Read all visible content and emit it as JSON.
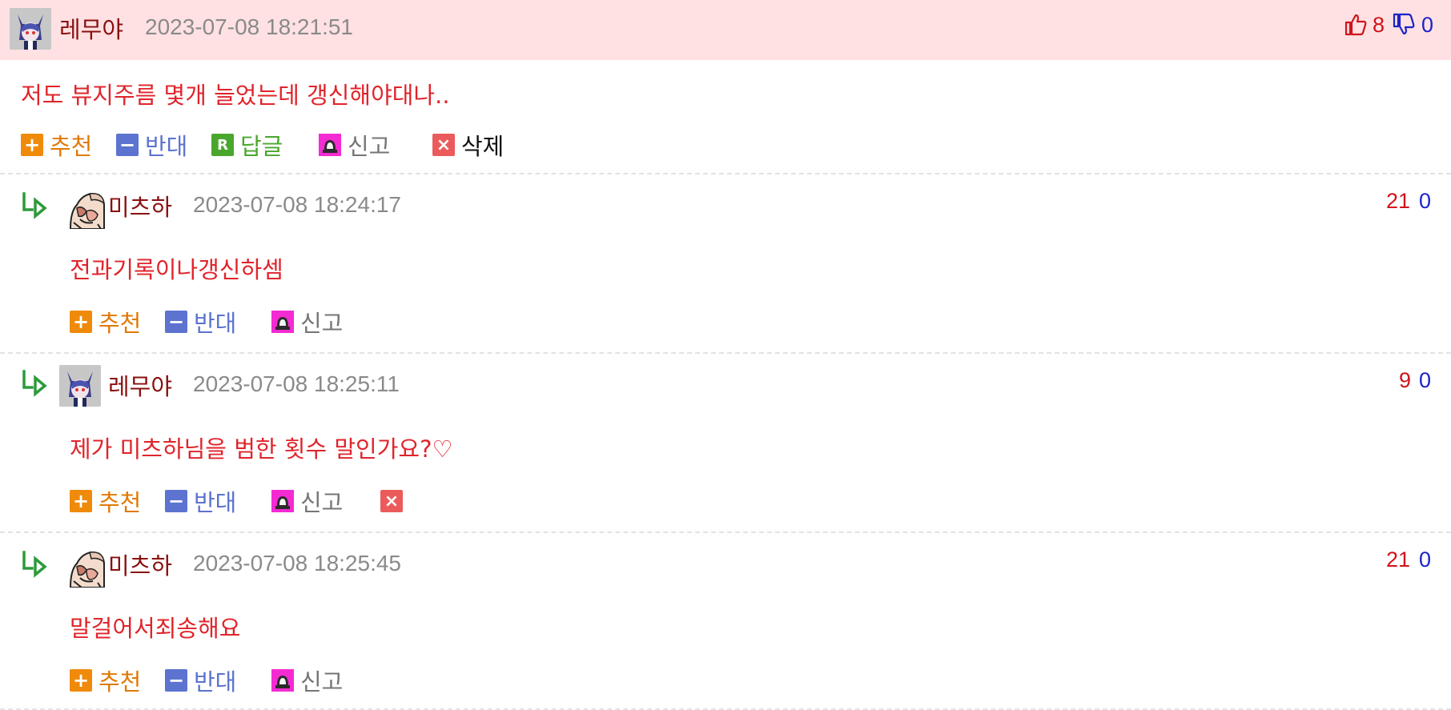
{
  "comments": [
    {
      "nick": "레무야",
      "date": "2023-07-08 18:21:51",
      "text": "저도 뷰지주름 몇개 늘었는데 갱신해야대나..",
      "up": "8",
      "down": "0",
      "actions": {
        "recommend": "추천",
        "oppose": "반대",
        "reply": "답글",
        "report": "신고",
        "delete": "삭제"
      }
    },
    {
      "nick": "미츠하",
      "date": "2023-07-08 18:24:17",
      "text": "전과기록이나갱신하셈",
      "up": "21",
      "down": "0",
      "actions": {
        "recommend": "추천",
        "oppose": "반대",
        "report": "신고"
      }
    },
    {
      "nick": "레무야",
      "date": "2023-07-08 18:25:11",
      "text": "제가 미츠하님을 범한 횟수 말인가요?♡",
      "up": "9",
      "down": "0",
      "actions": {
        "recommend": "추천",
        "oppose": "반대",
        "report": "신고"
      }
    },
    {
      "nick": "미츠하",
      "date": "2023-07-08 18:25:45",
      "text": "말걸어서죄송해요",
      "up": "21",
      "down": "0",
      "actions": {
        "recommend": "추천",
        "oppose": "반대",
        "report": "신고"
      }
    }
  ],
  "icons": {
    "thumbs_up": "thumbs-up-icon",
    "thumbs_down": "thumbs-down-icon",
    "reply_arrow": "reply-arrow-icon",
    "report": "siren-icon",
    "delete": "close-icon"
  },
  "colors": {
    "header_band": "#ffe1e3",
    "nick": "#8a1010",
    "body_text": "#e0242b",
    "up": "#d0121c",
    "down": "#1b23c8",
    "recommend": "#f08a0a",
    "oppose": "#5c73cf",
    "reply": "#4aa72d",
    "report": "#f42bd3",
    "delete": "#ec5b5b"
  }
}
